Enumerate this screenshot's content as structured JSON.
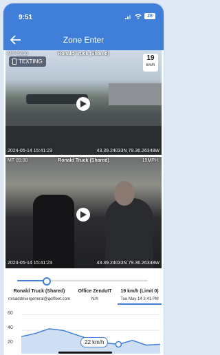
{
  "status_bar": {
    "time": "9:51",
    "battery": "28"
  },
  "app_bar": {
    "title": "Zone Enter"
  },
  "video_top": {
    "camera_label": "Ronald Truck (Shared)",
    "corner_text": "MT 03:00",
    "tag": "TEXTING",
    "speed": "19",
    "speed_unit": "km/h",
    "timestamp": "2024-05-14 15:41:23",
    "coords": "43.39.24033N 79.36.26348W"
  },
  "video_bottom": {
    "camera_label": "Ronald Truck (Shared)",
    "corner_text": "MT 05:00",
    "speed_overlay": "19MPH",
    "timestamp": "2024-05-14 15:41:23",
    "coords": "43.39.24033N 79.36.26348W"
  },
  "scrubber": {
    "progress": 0.22
  },
  "info": {
    "vehicle": "Ronald Truck (Shared)",
    "email": "ronalddrivergeneral@golfleet.com",
    "office": "Office ZenduIT",
    "office_sub": "N/A",
    "speed_limit": "19 km/h (Limit 0)",
    "date": "Tue May 14 3:41 PM"
  },
  "graph": {
    "y_ticks": [
      "60",
      "40",
      "20"
    ],
    "tooltip": "22 km/h"
  },
  "chart_data": {
    "type": "area",
    "x": [
      0,
      1,
      2,
      3,
      4,
      5,
      6,
      7,
      8,
      9,
      10
    ],
    "values": [
      32,
      36,
      42,
      40,
      34,
      28,
      24,
      22,
      27,
      21,
      22
    ],
    "ylim": [
      10,
      65
    ],
    "grid": true
  }
}
